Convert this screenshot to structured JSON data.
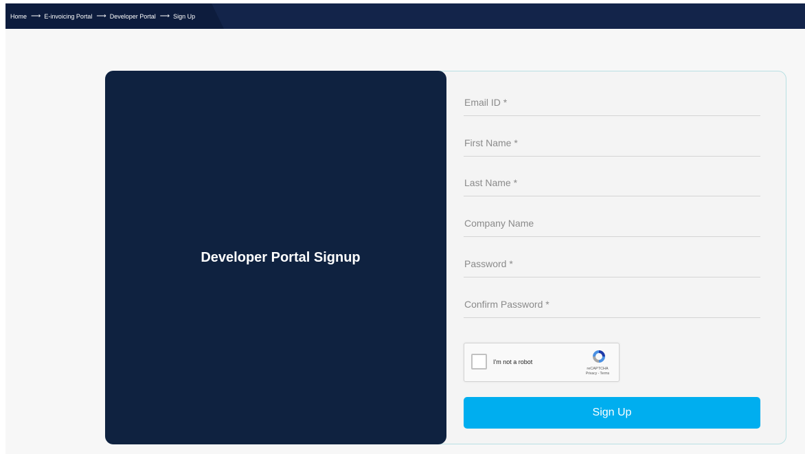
{
  "breadcrumb": {
    "items": [
      "Home",
      "E-invoicing Portal",
      "Developer Portal",
      "Sign Up"
    ],
    "separator": "⟶"
  },
  "left_panel": {
    "title": "Developer Portal Signup"
  },
  "form": {
    "fields": [
      {
        "placeholder": "Email ID *",
        "value": ""
      },
      {
        "placeholder": "First Name *",
        "value": ""
      },
      {
        "placeholder": "Last Name *",
        "value": ""
      },
      {
        "placeholder": "Company Name",
        "value": ""
      },
      {
        "placeholder": "Password *",
        "value": ""
      },
      {
        "placeholder": "Confirm Password *",
        "value": ""
      }
    ],
    "captcha": {
      "label": "I'm not a robot",
      "brand": "reCAPTCHA",
      "links": "Privacy - Terms",
      "icon": "recaptcha-logo-icon"
    },
    "submit_label": "Sign Up"
  },
  "colors": {
    "topbar": "#13244a",
    "panel": "#0f2240",
    "accent": "#00aeef"
  }
}
